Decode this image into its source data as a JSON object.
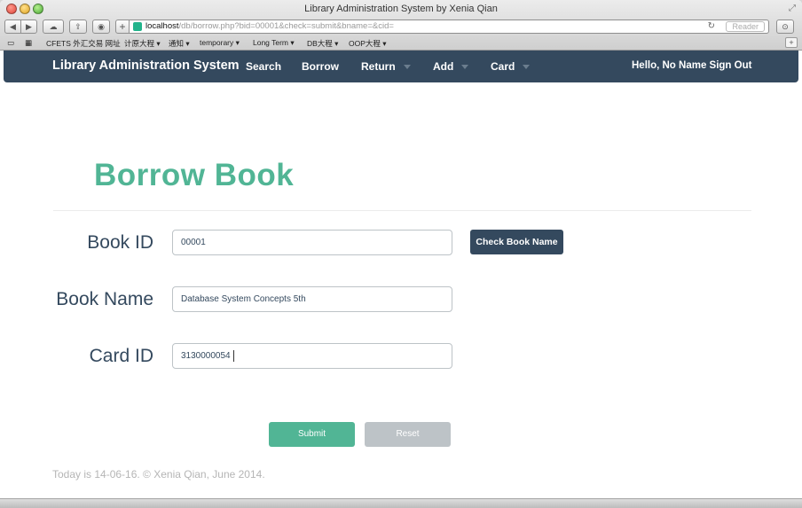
{
  "window": {
    "title": "Library Administration System by Xenia Qian"
  },
  "browser": {
    "url_host": "localhost",
    "url_path": "/db/borrow.php?bid=00001&check=submit&bname=&cid=",
    "reader_label": "Reader",
    "bookmarks": [
      "CFETS 外汇交易 网址",
      "计原大程 ▾",
      "通知 ▾",
      "temporary ▾",
      "Long Term ▾",
      "DB大程 ▾",
      "OOP大程 ▾"
    ]
  },
  "navbar": {
    "brand": "Library Administration System",
    "items": [
      {
        "label": "Search"
      },
      {
        "label": "Borrow"
      },
      {
        "label": "Return"
      },
      {
        "label": "Add"
      },
      {
        "label": "Card"
      }
    ],
    "user_text": "Hello, No Name Sign Out"
  },
  "form": {
    "heading": "Borrow Book",
    "book_id_label": "Book ID",
    "book_id_value": "00001",
    "book_name_label": "Book Name",
    "book_name_value": "Database System Concepts 5th",
    "card_id_label": "Card ID",
    "card_id_value": "3130000054",
    "check_button": "Check Book Name",
    "submit_button": "Submit",
    "reset_button": "Reset"
  },
  "footer": {
    "text": "Today is 14-06-16.  © Xenia Qian, June 2014."
  },
  "colors": {
    "accent": "#51b595",
    "navbar": "#34495e",
    "muted_button": "#bdc3c7"
  }
}
